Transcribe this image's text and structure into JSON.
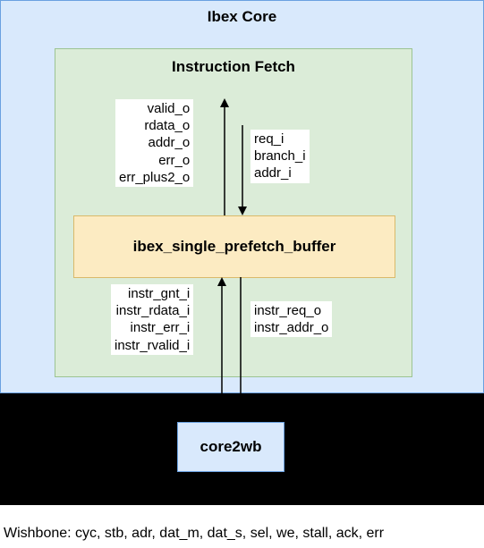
{
  "core": {
    "title": "Ibex Core"
  },
  "if_block": {
    "title": "Instruction Fetch",
    "outputs_up": [
      "valid_o",
      "rdata_o",
      "addr_o",
      "err_o",
      "err_plus2_o"
    ],
    "inputs_down": [
      "req_i",
      "branch_i",
      "addr_i"
    ],
    "inputs_up": [
      "instr_gnt_i",
      "instr_rdata_i",
      "instr_err_i",
      "instr_rvalid_i"
    ],
    "outputs_down": [
      "instr_req_o",
      "instr_addr_o"
    ]
  },
  "buffer": {
    "label": "ibex_single_prefetch_buffer"
  },
  "core2wb": {
    "label": "core2wb"
  },
  "wishbone": {
    "text": "Wishbone: cyc, stb, adr, dat_m, dat_s, sel, we, stall, ack, err"
  }
}
